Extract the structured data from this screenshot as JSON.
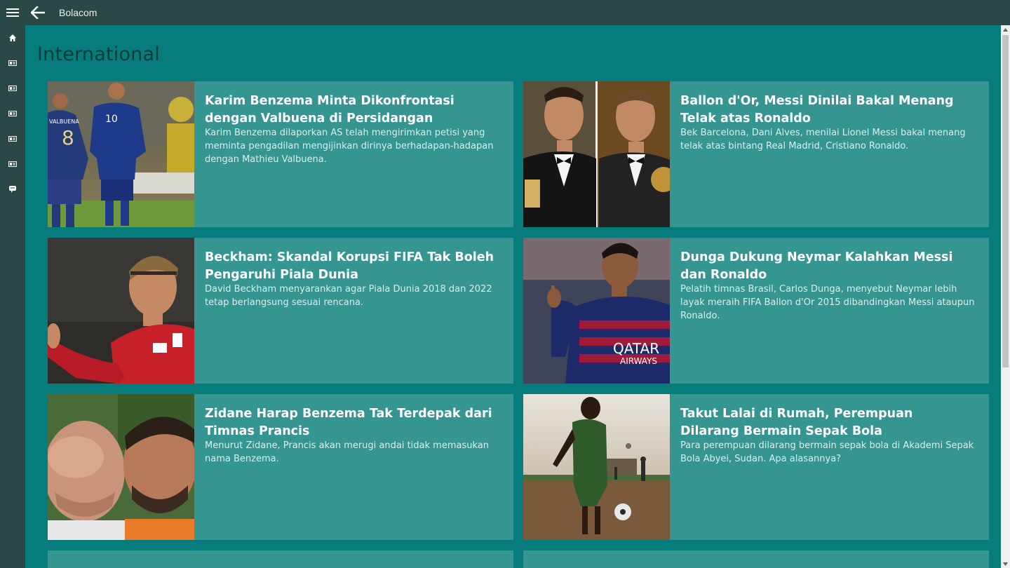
{
  "app": {
    "title": "Bolacom"
  },
  "icons": {
    "menu": "hamburger-icon",
    "back": "arrow-left-icon",
    "sidebar": [
      "home-icon",
      "category-icon",
      "category-icon",
      "category-icon",
      "category-icon",
      "category-icon",
      "chat-icon"
    ]
  },
  "page": {
    "title": "International"
  },
  "articles": [
    {
      "headline": "Karim Benzema Minta Dikonfrontasi dengan Valbuena di Persidangan",
      "summary": "Karim Benzema dilaporkan AS telah mengirimkan petisi yang meminta pengadilan mengijinkan dirinya berhadapan-hadapan dengan Mathieu Valbuena."
    },
    {
      "headline": "Ballon d'Or, Messi Dinilai Bakal Menang Telak atas Ronaldo",
      "summary": "Bek Barcelona, Dani Alves, menilai Lionel Messi bakal menang telak atas bintang Real Madrid, Cristiano Ronaldo."
    },
    {
      "headline": "Beckham: Skandal Korupsi FIFA Tak Boleh Pengaruhi Piala Dunia",
      "summary": "David Beckham menyarankan agar Piala Dunia 2018 dan 2022 tetap berlangsung sesuai rencana."
    },
    {
      "headline": "Dunga Dukung Neymar Kalahkan Messi dan Ronaldo",
      "summary": "Pelatih timnas Brasil, Carlos Dunga, menyebut Neymar lebih layak meraih FIFA Ballon d'Or 2015 dibandingkan Messi ataupun Ronaldo."
    },
    {
      "headline": "Zidane Harap Benzema Tak Terdepak dari Timnas Prancis",
      "summary": "Menurut Zidane, Prancis akan merugi andai tidak memasukan nama Benzema."
    },
    {
      "headline": "Takut Lalai di Rumah, Perempuan Dilarang Bermain Sepak Bola",
      "summary": "Para perempuan dilarang bermain sepak bola di Akademi Sepak Bola Abyei, Sudan. Apa alasannya?"
    }
  ],
  "photo_text": {
    "jersey_name": "VALBUENA",
    "jersey_number_1": "8",
    "jersey_number_2": "10",
    "sponsor": "QATAR",
    "sponsor_sub": "AIRWAYS"
  }
}
